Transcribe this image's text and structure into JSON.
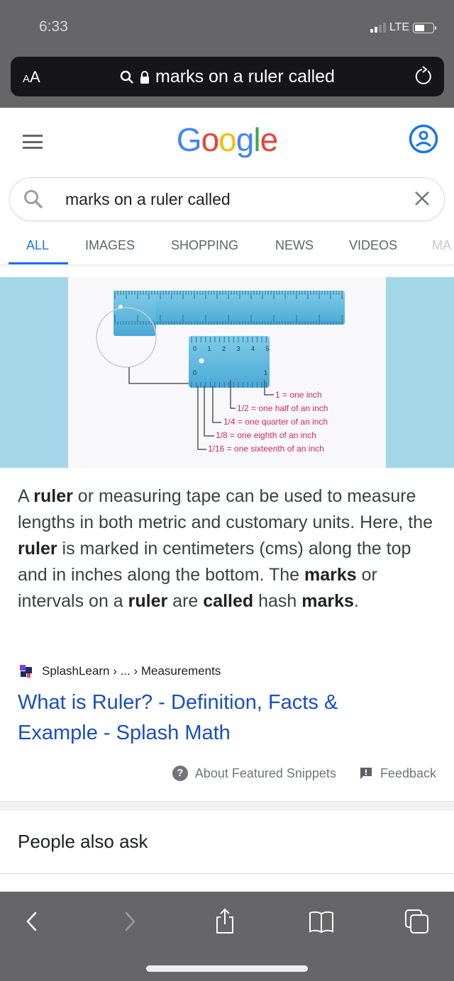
{
  "status_bar": {
    "time": "6:33",
    "network": "LTE",
    "signal_bars": 2,
    "signal_max": 4,
    "battery_level": 0.55
  },
  "browser": {
    "aa_label_small": "A",
    "aa_label_large": "A",
    "url_text": "marks on a ruler called"
  },
  "google": {
    "logo_letters": [
      {
        "char": "G",
        "color": "#4285f4"
      },
      {
        "char": "o",
        "color": "#ea4335"
      },
      {
        "char": "o",
        "color": "#fbbc05"
      },
      {
        "char": "g",
        "color": "#4285f4"
      },
      {
        "char": "l",
        "color": "#34a853"
      },
      {
        "char": "e",
        "color": "#ea4335"
      }
    ],
    "search_query": "marks on a ruler called",
    "tabs": [
      {
        "label": "ALL",
        "active": true
      },
      {
        "label": "IMAGES",
        "active": false
      },
      {
        "label": "SHOPPING",
        "active": false
      },
      {
        "label": "NEWS",
        "active": false
      },
      {
        "label": "VIDEOS",
        "active": false
      },
      {
        "label": "MA",
        "active": false
      }
    ]
  },
  "ruler_image": {
    "labels": [
      "1 = one inch",
      "1/2 = one half of an inch",
      "1/4 = one quarter of an inch",
      "1/8 = one eighth of an inch",
      "1/16 = one sixteenth of an inch"
    ],
    "small_ruler_numbers": [
      "0",
      "1",
      "2",
      "3",
      "4",
      "5"
    ],
    "inch_marks": [
      "0",
      "1"
    ],
    "label_color": "#d6285a"
  },
  "snippet": {
    "segments": [
      {
        "t": "A ",
        "b": false
      },
      {
        "t": "ruler",
        "b": true
      },
      {
        "t": " or measuring tape can be used to measure lengths in both metric and customary units. Here, the ",
        "b": false
      },
      {
        "t": "ruler",
        "b": true
      },
      {
        "t": " is marked in centimeters (cms) along the top and in inches along the bottom. The ",
        "b": false
      },
      {
        "t": "marks",
        "b": true
      },
      {
        "t": " or intervals on a ",
        "b": false
      },
      {
        "t": "ruler",
        "b": true
      },
      {
        "t": " are ",
        "b": false
      },
      {
        "t": "called",
        "b": true
      },
      {
        "t": " hash ",
        "b": false
      },
      {
        "t": "marks",
        "b": true
      },
      {
        "t": ".",
        "b": false
      }
    ]
  },
  "source": {
    "site": "SplashLearn",
    "breadcrumb": " › ... › Measurements",
    "title": "What is Ruler? - Definition, Facts & Example - Splash Math"
  },
  "footer": {
    "about_label": "About Featured Snippets",
    "feedback_label": "Feedback"
  },
  "people_also_ask": "People also ask",
  "toolbar": {
    "back": "back",
    "forward": "forward",
    "share": "share",
    "bookmarks": "bookmarks",
    "tabs": "tabs"
  }
}
